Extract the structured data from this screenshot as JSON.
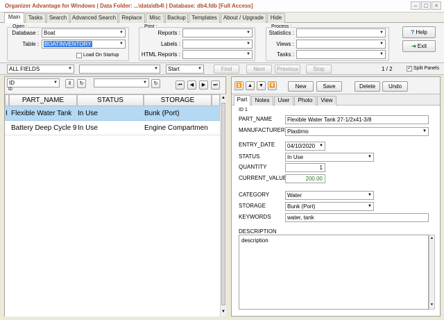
{
  "app": {
    "title": "Organizer Advantage for Windows | Data Folder: ...\\data\\db4\\ | Database: db4.fdb [Full Access]"
  },
  "menu": {
    "tabs": [
      "Main",
      "Tasks",
      "Search",
      "Advanced Search",
      "Replace",
      "Misc",
      "Backup",
      "Templates",
      "About / Upgrade",
      "Hide"
    ]
  },
  "open": {
    "group_label": "Open :",
    "database_label": "Database :",
    "database_value": "Boat",
    "table_label": "Table :",
    "table_value": "BOATINVENTORY",
    "load_on_startup": "Load On Startup"
  },
  "print": {
    "group_label": "Print :",
    "reports_label": "Reports :",
    "labels_label": "Labels :",
    "html_reports_label": "HTML Reports :"
  },
  "process": {
    "group_label": "Process :",
    "statistics_label": "Statistics :",
    "views_label": "Views :",
    "tasks_label": "Tasks :"
  },
  "buttons": {
    "help": "Help",
    "exit": "Exit"
  },
  "findbar": {
    "field_select": "ALL FIELDS",
    "mode_select": "Start",
    "find": "Find",
    "next": "Next",
    "previous": "Previous",
    "stop": "Stop",
    "page_count": "1 / 2",
    "split_panels": "Split Panels"
  },
  "sort": {
    "field": "ID",
    "sub": "ID"
  },
  "grid": {
    "columns": [
      "PART_NAME",
      "STATUS",
      "STORAGE"
    ],
    "rows": [
      {
        "marker": "I",
        "part": "Flexible Water Tank",
        "status": "In Use",
        "storage": "Bunk (Port)"
      },
      {
        "marker": "",
        "part": "Battery Deep Cycle 9",
        "status": "In Use",
        "storage": "Engine Compartmen"
      }
    ]
  },
  "record": {
    "new": "New",
    "save": "Save",
    "delete": "Delete",
    "undo": "Undo",
    "tabs": [
      "Part",
      "Notes",
      "User",
      "Photo",
      "View"
    ],
    "id_label": "ID 1",
    "part_name_label": "PART_NAME",
    "part_name": "Flexible Water Tank  27-1/2x41-3/8",
    "manufacturer_label": "MANUFACTURER",
    "manufacturer": "Plastimo",
    "entry_date_label": "ENTRY_DATE",
    "entry_date": "04/10/2020",
    "status_label": "STATUS",
    "status": "In Use",
    "quantity_label": "QUANTITY",
    "quantity": "1",
    "current_value_label": "CURRENT_VALUE",
    "current_value": "200.00",
    "category_label": "CATEGORY",
    "category": "Water",
    "storage_label": "STORAGE",
    "storage": "Bunk (Port)",
    "keywords_label": "KEYWORDS",
    "keywords": "water, tank",
    "description_label": "DESCRIPTION",
    "description": "description"
  },
  "colors": {
    "title": "#b24b2c",
    "selection": "#b5d9f2",
    "value_green": "#1a7a1a",
    "table_highlight": "#3d7fe0"
  }
}
